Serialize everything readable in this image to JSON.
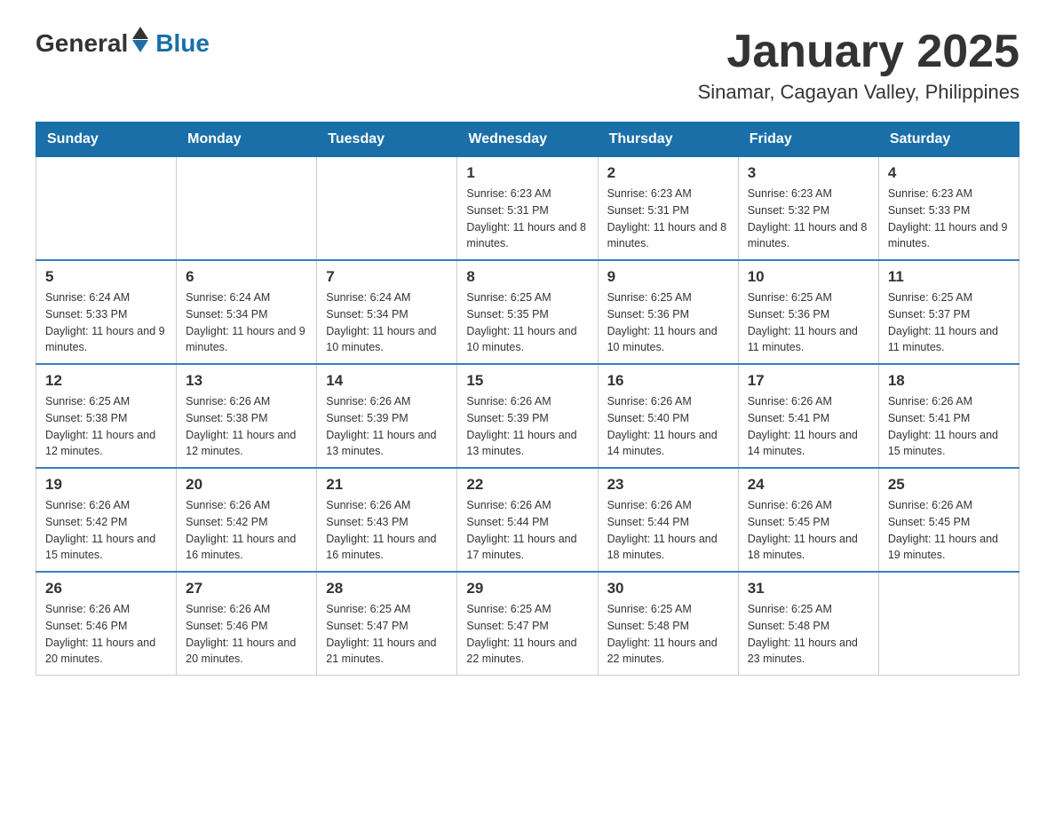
{
  "header": {
    "logo_general": "General",
    "logo_blue": "Blue",
    "title": "January 2025",
    "subtitle": "Sinamar, Cagayan Valley, Philippines"
  },
  "days_of_week": [
    "Sunday",
    "Monday",
    "Tuesday",
    "Wednesday",
    "Thursday",
    "Friday",
    "Saturday"
  ],
  "weeks": [
    [
      {
        "day": "",
        "info": ""
      },
      {
        "day": "",
        "info": ""
      },
      {
        "day": "",
        "info": ""
      },
      {
        "day": "1",
        "info": "Sunrise: 6:23 AM\nSunset: 5:31 PM\nDaylight: 11 hours and 8 minutes."
      },
      {
        "day": "2",
        "info": "Sunrise: 6:23 AM\nSunset: 5:31 PM\nDaylight: 11 hours and 8 minutes."
      },
      {
        "day": "3",
        "info": "Sunrise: 6:23 AM\nSunset: 5:32 PM\nDaylight: 11 hours and 8 minutes."
      },
      {
        "day": "4",
        "info": "Sunrise: 6:23 AM\nSunset: 5:33 PM\nDaylight: 11 hours and 9 minutes."
      }
    ],
    [
      {
        "day": "5",
        "info": "Sunrise: 6:24 AM\nSunset: 5:33 PM\nDaylight: 11 hours and 9 minutes."
      },
      {
        "day": "6",
        "info": "Sunrise: 6:24 AM\nSunset: 5:34 PM\nDaylight: 11 hours and 9 minutes."
      },
      {
        "day": "7",
        "info": "Sunrise: 6:24 AM\nSunset: 5:34 PM\nDaylight: 11 hours and 10 minutes."
      },
      {
        "day": "8",
        "info": "Sunrise: 6:25 AM\nSunset: 5:35 PM\nDaylight: 11 hours and 10 minutes."
      },
      {
        "day": "9",
        "info": "Sunrise: 6:25 AM\nSunset: 5:36 PM\nDaylight: 11 hours and 10 minutes."
      },
      {
        "day": "10",
        "info": "Sunrise: 6:25 AM\nSunset: 5:36 PM\nDaylight: 11 hours and 11 minutes."
      },
      {
        "day": "11",
        "info": "Sunrise: 6:25 AM\nSunset: 5:37 PM\nDaylight: 11 hours and 11 minutes."
      }
    ],
    [
      {
        "day": "12",
        "info": "Sunrise: 6:25 AM\nSunset: 5:38 PM\nDaylight: 11 hours and 12 minutes."
      },
      {
        "day": "13",
        "info": "Sunrise: 6:26 AM\nSunset: 5:38 PM\nDaylight: 11 hours and 12 minutes."
      },
      {
        "day": "14",
        "info": "Sunrise: 6:26 AM\nSunset: 5:39 PM\nDaylight: 11 hours and 13 minutes."
      },
      {
        "day": "15",
        "info": "Sunrise: 6:26 AM\nSunset: 5:39 PM\nDaylight: 11 hours and 13 minutes."
      },
      {
        "day": "16",
        "info": "Sunrise: 6:26 AM\nSunset: 5:40 PM\nDaylight: 11 hours and 14 minutes."
      },
      {
        "day": "17",
        "info": "Sunrise: 6:26 AM\nSunset: 5:41 PM\nDaylight: 11 hours and 14 minutes."
      },
      {
        "day": "18",
        "info": "Sunrise: 6:26 AM\nSunset: 5:41 PM\nDaylight: 11 hours and 15 minutes."
      }
    ],
    [
      {
        "day": "19",
        "info": "Sunrise: 6:26 AM\nSunset: 5:42 PM\nDaylight: 11 hours and 15 minutes."
      },
      {
        "day": "20",
        "info": "Sunrise: 6:26 AM\nSunset: 5:42 PM\nDaylight: 11 hours and 16 minutes."
      },
      {
        "day": "21",
        "info": "Sunrise: 6:26 AM\nSunset: 5:43 PM\nDaylight: 11 hours and 16 minutes."
      },
      {
        "day": "22",
        "info": "Sunrise: 6:26 AM\nSunset: 5:44 PM\nDaylight: 11 hours and 17 minutes."
      },
      {
        "day": "23",
        "info": "Sunrise: 6:26 AM\nSunset: 5:44 PM\nDaylight: 11 hours and 18 minutes."
      },
      {
        "day": "24",
        "info": "Sunrise: 6:26 AM\nSunset: 5:45 PM\nDaylight: 11 hours and 18 minutes."
      },
      {
        "day": "25",
        "info": "Sunrise: 6:26 AM\nSunset: 5:45 PM\nDaylight: 11 hours and 19 minutes."
      }
    ],
    [
      {
        "day": "26",
        "info": "Sunrise: 6:26 AM\nSunset: 5:46 PM\nDaylight: 11 hours and 20 minutes."
      },
      {
        "day": "27",
        "info": "Sunrise: 6:26 AM\nSunset: 5:46 PM\nDaylight: 11 hours and 20 minutes."
      },
      {
        "day": "28",
        "info": "Sunrise: 6:25 AM\nSunset: 5:47 PM\nDaylight: 11 hours and 21 minutes."
      },
      {
        "day": "29",
        "info": "Sunrise: 6:25 AM\nSunset: 5:47 PM\nDaylight: 11 hours and 22 minutes."
      },
      {
        "day": "30",
        "info": "Sunrise: 6:25 AM\nSunset: 5:48 PM\nDaylight: 11 hours and 22 minutes."
      },
      {
        "day": "31",
        "info": "Sunrise: 6:25 AM\nSunset: 5:48 PM\nDaylight: 11 hours and 23 minutes."
      },
      {
        "day": "",
        "info": ""
      }
    ]
  ]
}
